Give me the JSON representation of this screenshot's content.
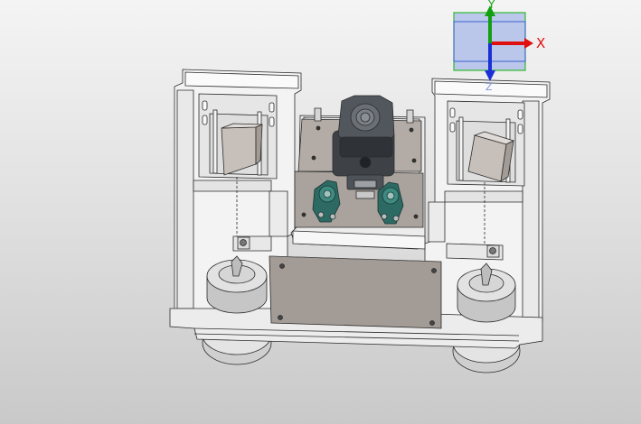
{
  "viewport": {
    "background_top": "#f4f4f4",
    "background_bottom": "#c9c9c9"
  },
  "model": {
    "frame_color": "#f3f3f3",
    "line_color": "#2b2b2b",
    "plate_color": "#a29b96",
    "motor_color": "#4a4e54",
    "bearing_color": "#2e6a64",
    "block_color": "#cfc8c1"
  },
  "triad": {
    "x_label": "X",
    "y_label": "Y",
    "z_label": "Z",
    "x_color": "#e01010",
    "y_color": "#12a012",
    "z_color": "#1a2fd6",
    "plane_fill": "#aebde8",
    "plane_outline": "#2fb82f"
  }
}
